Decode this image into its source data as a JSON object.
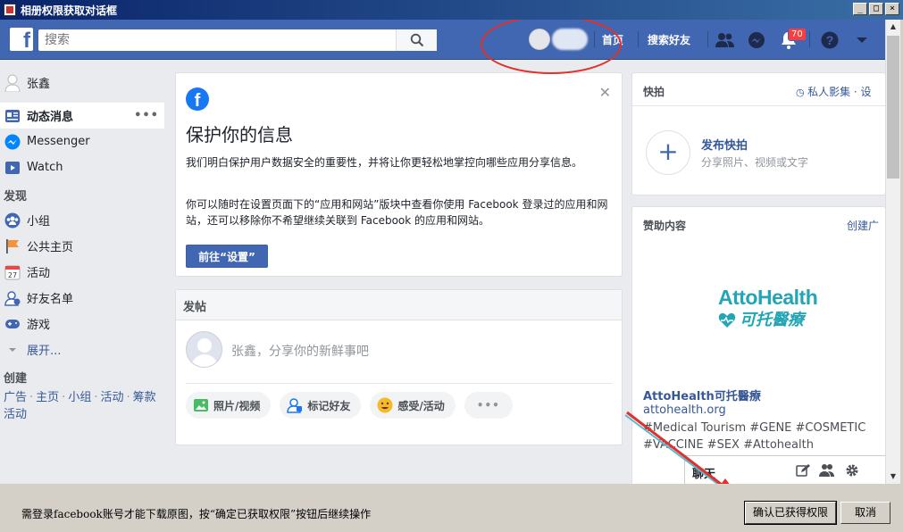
{
  "window": {
    "title": "相册权限获取对话框"
  },
  "fb": {
    "search_placeholder": "搜索",
    "nav_home": "首页",
    "nav_find_friends": "搜索好友",
    "notif_count": "70"
  },
  "sidebar": {
    "user_name": "张鑫",
    "items": [
      {
        "label": "动态消息"
      },
      {
        "label": "Messenger"
      },
      {
        "label": "Watch"
      }
    ],
    "discover_head": "发现",
    "discover": [
      {
        "label": "小组"
      },
      {
        "label": "公共主页"
      },
      {
        "label": "活动"
      },
      {
        "label": "好友名单"
      },
      {
        "label": "游戏"
      },
      {
        "label": "展开..."
      }
    ],
    "create_head": "创建",
    "create_links": [
      "广告",
      "主页",
      "小组",
      "活动",
      "筹款活动"
    ]
  },
  "privacy": {
    "title": "保护你的信息",
    "p1": "我们明白保护用户数据安全的重要性，并将让你更轻松地掌控向哪些应用分享信息。",
    "p2": "你可以随时在设置页面下的“应用和网站”版块中查看你使用 Facebook 登录过的应用和网站，还可以移除你不希望继续关联到 Facebook 的应用和网站。",
    "button": "前往“设置”"
  },
  "compose": {
    "head": "发帖",
    "placeholder": "张鑫，分享你的新鲜事吧",
    "actions": [
      "照片/视频",
      "标记好友",
      "感受/活动"
    ]
  },
  "stories": {
    "head": "快拍",
    "links": "私人影集 · 设",
    "title": "发布快拍",
    "sub": "分享照片、视频或文字"
  },
  "ads": {
    "head": "赞助内容",
    "create": "创建广",
    "logo_line1": "AttoHealth",
    "logo_line2": "可托醫療",
    "name": "AttoHealth可托醫療",
    "url": "attohealth.org",
    "tags": "#Medical Tourism #GENE #COSMETIC #VACCINE #SEX #Attohealth"
  },
  "chat": {
    "title": "聊天"
  },
  "dialog": {
    "message": "需登录facebook账号才能下载原图，按“确定已获取权限”按钮后继续操作",
    "ok": "确认已获得权限",
    "cancel": "取消"
  },
  "colors": {
    "fb_blue": "#4267b2",
    "annotation_red": "#e0312b"
  }
}
